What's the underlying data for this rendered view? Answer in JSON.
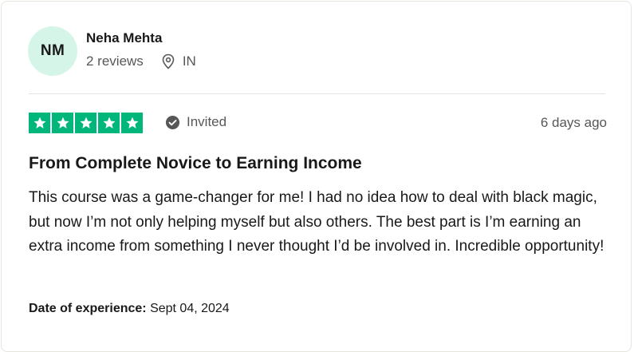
{
  "review": {
    "avatar_initials": "NM",
    "reviewer_name": "Neha Mehta",
    "review_count": "2 reviews",
    "country": "IN",
    "rating": 5,
    "rating_max": 5,
    "invited_label": "Invited",
    "posted_ago": "6 days ago",
    "title": "From Complete Novice to Earning Income",
    "body": "This course was a game-changer for me! I had no idea how to deal with black magic, but now I’m not only helping myself but also others. The best part is I’m earning an extra income from something I never thought I’d be involved in. Incredible opportunity!",
    "experience_label": "Date of experience:",
    "experience_date": "Sept 04, 2024"
  },
  "icons": {
    "location": "location-pin-icon",
    "invited": "check-circle-icon",
    "star": "star-icon"
  },
  "colors": {
    "star_green": "#00b67a",
    "avatar_bg": "#d6f5e9",
    "muted_text": "#575757",
    "divider": "#e5e5dd"
  }
}
